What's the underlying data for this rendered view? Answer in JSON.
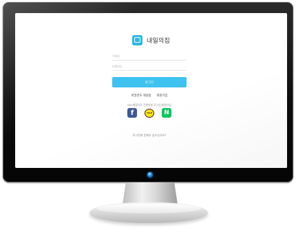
{
  "brand": {
    "name": "내일의집",
    "icon": "home-chat-icon",
    "color": "#2fb8e6"
  },
  "login_form": {
    "email_placeholder": "이메일",
    "password_placeholder": "비밀번호",
    "login_button": "로그인",
    "button_color": "#3ec2f0"
  },
  "links": {
    "reset_password": "비밀번호 재설정",
    "signup": "회원가입"
  },
  "sns": {
    "caption": "SNS계정으로 간편하게 로그인/회원가입",
    "buttons": [
      {
        "name": "facebook",
        "glyph": "f",
        "color": "#3b5998"
      },
      {
        "name": "kakao",
        "glyph": "TALK",
        "color": "#ffe812"
      },
      {
        "name": "naver",
        "glyph": "N",
        "color": "#03c75a"
      }
    ]
  },
  "help_link": "로그인에 문제가 있으신가요?"
}
